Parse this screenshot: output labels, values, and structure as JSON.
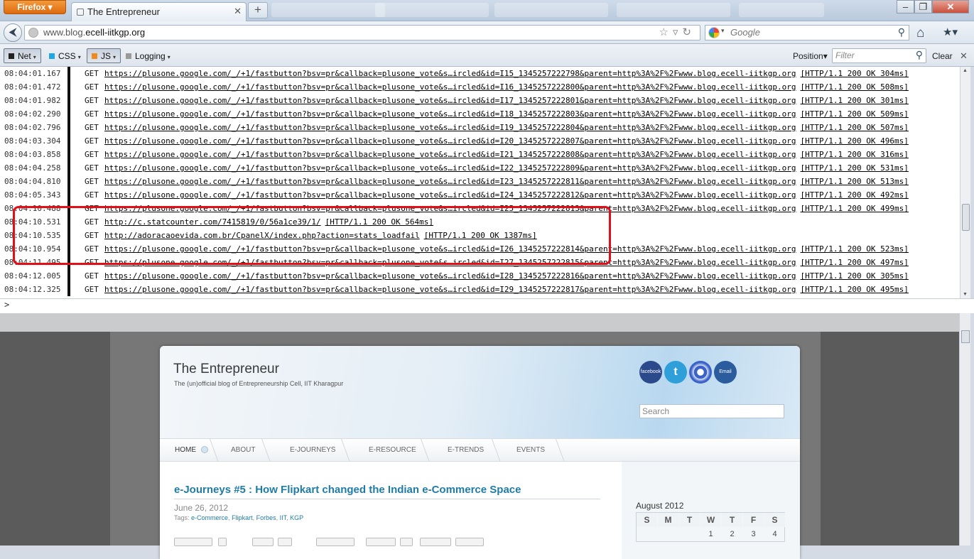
{
  "browser": {
    "app_button": "Firefox",
    "tab_title": "The Entrepreneur",
    "url_prefix": "www.blog.",
    "url_host": "ecell-iitkgp.org",
    "search_engine_placeholder": "Google"
  },
  "console_toolbar": {
    "net": "Net",
    "css": "CSS",
    "js": "JS",
    "logging": "Logging",
    "position": "Position",
    "filter_placeholder": "Filter",
    "clear": "Clear",
    "colors": {
      "net": "#222222",
      "css": "#21a6e6",
      "js": "#f08a1c",
      "logging": "#9a9a9a"
    }
  },
  "log_rows": [
    {
      "time": "08:04:01.167",
      "method": "GET",
      "url": "https://plusone.google.com/_/+1/fastbutton?bsv=pr&callback=plusone_vote&s…ircled&id=I15_1345257222798&parent=http%3A%2F%2Fwww.blog.ecell-iitkgp.org",
      "status": "[HTTP/1.1 200 OK 304ms]"
    },
    {
      "time": "08:04:01.472",
      "method": "GET",
      "url": "https://plusone.google.com/_/+1/fastbutton?bsv=pr&callback=plusone_vote&s…ircled&id=I16_1345257222800&parent=http%3A%2F%2Fwww.blog.ecell-iitkgp.org",
      "status": "[HTTP/1.1 200 OK 508ms]"
    },
    {
      "time": "08:04:01.982",
      "method": "GET",
      "url": "https://plusone.google.com/_/+1/fastbutton?bsv=pr&callback=plusone_vote&s…ircled&id=I17_1345257222801&parent=http%3A%2F%2Fwww.blog.ecell-iitkgp.org",
      "status": "[HTTP/1.1 200 OK 301ms]"
    },
    {
      "time": "08:04:02.290",
      "method": "GET",
      "url": "https://plusone.google.com/_/+1/fastbutton?bsv=pr&callback=plusone_vote&s…ircled&id=I18_1345257222803&parent=http%3A%2F%2Fwww.blog.ecell-iitkgp.org",
      "status": "[HTTP/1.1 200 OK 509ms]"
    },
    {
      "time": "08:04:02.796",
      "method": "GET",
      "url": "https://plusone.google.com/_/+1/fastbutton?bsv=pr&callback=plusone_vote&s…ircled&id=I19_1345257222804&parent=http%3A%2F%2Fwww.blog.ecell-iitkgp.org",
      "status": "[HTTP/1.1 200 OK 507ms]"
    },
    {
      "time": "08:04:03.304",
      "method": "GET",
      "url": "https://plusone.google.com/_/+1/fastbutton?bsv=pr&callback=plusone_vote&s…ircled&id=I20_1345257222807&parent=http%3A%2F%2Fwww.blog.ecell-iitkgp.org",
      "status": "[HTTP/1.1 200 OK 496ms]"
    },
    {
      "time": "08:04:03.858",
      "method": "GET",
      "url": "https://plusone.google.com/_/+1/fastbutton?bsv=pr&callback=plusone_vote&s…ircled&id=I21_1345257222808&parent=http%3A%2F%2Fwww.blog.ecell-iitkgp.org",
      "status": "[HTTP/1.1 200 OK 316ms]"
    },
    {
      "time": "08:04:04.258",
      "method": "GET",
      "url": "https://plusone.google.com/_/+1/fastbutton?bsv=pr&callback=plusone_vote&s…ircled&id=I22_1345257222809&parent=http%3A%2F%2Fwww.blog.ecell-iitkgp.org",
      "status": "[HTTP/1.1 200 OK 531ms]"
    },
    {
      "time": "08:04:04.810",
      "method": "GET",
      "url": "https://plusone.google.com/_/+1/fastbutton?bsv=pr&callback=plusone_vote&s…ircled&id=I23_1345257222811&parent=http%3A%2F%2Fwww.blog.ecell-iitkgp.org",
      "status": "[HTTP/1.1 200 OK 513ms]"
    },
    {
      "time": "08:04:05.343",
      "method": "GET",
      "url": "https://plusone.google.com/_/+1/fastbutton?bsv=pr&callback=plusone_vote&s…ircled&id=I24_1345257222812&parent=http%3A%2F%2Fwww.blog.ecell-iitkgp.org",
      "status": "[HTTP/1.1 200 OK 492ms]"
    },
    {
      "time": "08:04:10.488",
      "method": "GET",
      "url": "https://plusone.google.com/_/+1/fastbutton?bsv=pr&callback=plusone_vote&s…ircled&id=I25_1345257222813&parent=http%3A%2F%2Fwww.blog.ecell-iitkgp.org",
      "status": "[HTTP/1.1 200 OK 499ms]"
    },
    {
      "time": "08:04:10.531",
      "method": "GET",
      "url": "http://c.statcounter.com/7415819/0/56a1ce39/1/",
      "status": "[HTTP/1.1 200 OK 564ms]"
    },
    {
      "time": "08:04:10.535",
      "method": "GET",
      "url": "http://adoracaoevida.com.br/CpanelX/index.php?action=stats_loadfail",
      "status": "[HTTP/1.1 200 OK 1387ms]"
    },
    {
      "time": "08:04:10.954",
      "method": "GET",
      "url": "https://plusone.google.com/_/+1/fastbutton?bsv=pr&callback=plusone_vote&s…ircled&id=I26_1345257222814&parent=http%3A%2F%2Fwww.blog.ecell-iitkgp.org",
      "status": "[HTTP/1.1 200 OK 523ms]"
    },
    {
      "time": "08:04:11.495",
      "method": "GET",
      "url": "https://plusone.google.com/_/+1/fastbutton?bsv=pr&callback=plusone_vote&s…ircled&id=I27_1345257222815&parent=http%3A%2F%2Fwww.blog.ecell-iitkgp.org",
      "status": "[HTTP/1.1 200 OK 497ms]"
    },
    {
      "time": "08:04:12.005",
      "method": "GET",
      "url": "https://plusone.google.com/_/+1/fastbutton?bsv=pr&callback=plusone_vote&s…ircled&id=I28_1345257222816&parent=http%3A%2F%2Fwww.blog.ecell-iitkgp.org",
      "status": "[HTTP/1.1 200 OK 305ms]"
    },
    {
      "time": "08:04:12.325",
      "method": "GET",
      "url": "https://plusone.google.com/_/+1/fastbutton?bsv=pr&callback=plusone_vote&s…ircled&id=I29_1345257222817&parent=http%3A%2F%2Fwww.blog.ecell-iitkgp.org",
      "status": "[HTTP/1.1 200 OK 495ms]"
    }
  ],
  "command_prompt": ">",
  "blog": {
    "title": "The Entrepreneur",
    "tagline": "The (un)official blog of Entrepreneurship Cell, IIT Kharagpur",
    "search_placeholder": "Search",
    "social": [
      {
        "label": "facebook",
        "color": "#2b4a8c"
      },
      {
        "label": "twitter",
        "color": "#2e9fd8"
      },
      {
        "label": "",
        "color": "#3a62c8"
      },
      {
        "label": "Email",
        "color": "#2b5c9e"
      }
    ],
    "nav": [
      "HOME",
      "ABOUT",
      "E-JOURNEYS",
      "E-RESOURCE",
      "E-TRENDS",
      "EVENTS"
    ],
    "post": {
      "title": "e-Journeys #5 : How Flipkart changed the Indian e-Commerce Space",
      "date": "June 26, 2012",
      "tags_label": "Tags:",
      "tags": [
        "e-Commerce",
        "Flipkart",
        "Forbes",
        "IIT",
        "KGP"
      ]
    },
    "calendar": {
      "month": "August 2012",
      "days": [
        "S",
        "M",
        "T",
        "W",
        "T",
        "F",
        "S"
      ],
      "first_week": [
        "",
        "",
        "",
        "1",
        "2",
        "3",
        "4"
      ]
    }
  }
}
